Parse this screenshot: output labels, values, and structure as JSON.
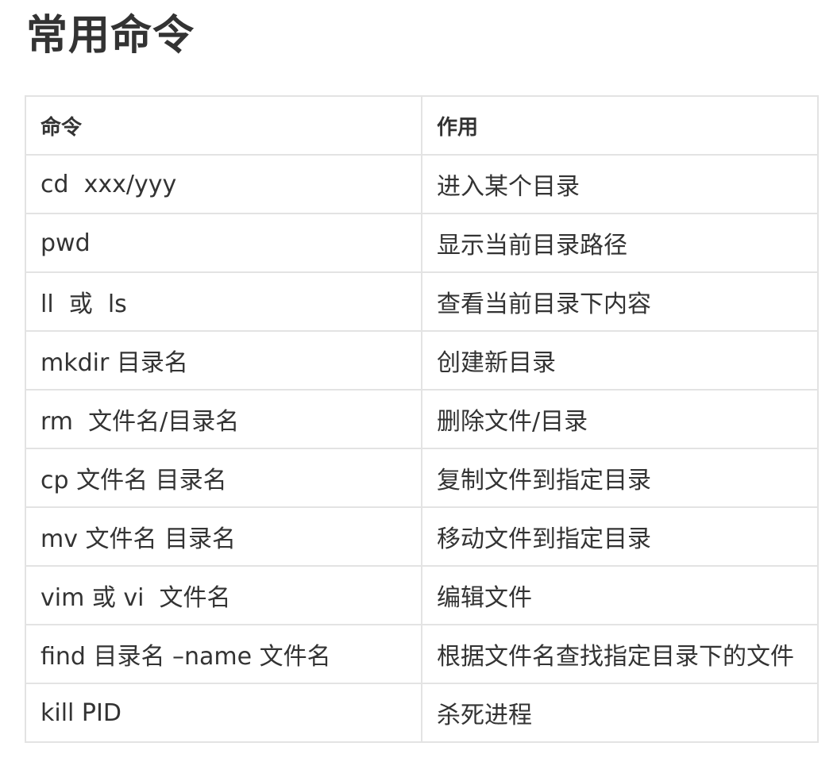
{
  "title": "常用命令",
  "table": {
    "headers": [
      "命令",
      "作用"
    ],
    "rows": [
      [
        "cd  xxx/yyy",
        "进入某个目录"
      ],
      [
        "pwd",
        "显示当前目录路径"
      ],
      [
        "ll  或  ls",
        "查看当前目录下内容"
      ],
      [
        "mkdir 目录名",
        "创建新目录"
      ],
      [
        "rm  文件名/目录名",
        "删除文件/目录"
      ],
      [
        "cp 文件名 目录名",
        "复制文件到指定目录"
      ],
      [
        "mv 文件名 目录名",
        "移动文件到指定目录"
      ],
      [
        "vim 或 vi  文件名",
        "编辑文件"
      ],
      [
        "find 目录名 –name 文件名",
        "根据文件名查找指定目录下的文件"
      ],
      [
        "kill PID",
        "杀死进程"
      ]
    ]
  }
}
